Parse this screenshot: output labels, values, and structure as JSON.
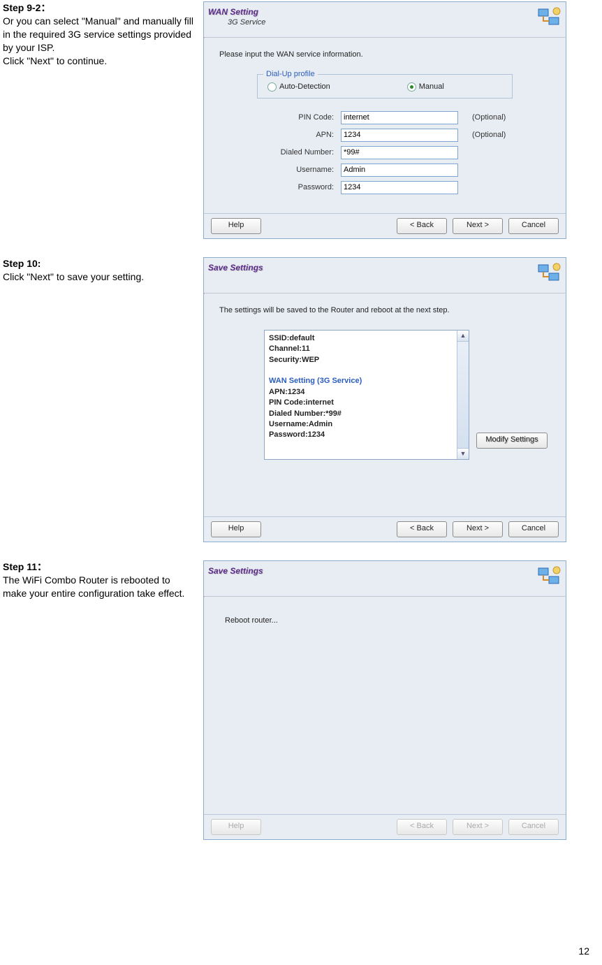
{
  "step9": {
    "title": "Step 9-2：",
    "body1": "Or you can select \"Manual\" and manually fill in the required 3G service settings provided by your ISP.",
    "body2": "Click \"Next\" to continue."
  },
  "step10": {
    "title": "Step 10:",
    "body1": "Click \"Next\" to save your setting."
  },
  "step11": {
    "title": "Step 11：",
    "body1": "The WiFi Combo Router is rebooted to make your entire configuration take effect."
  },
  "win1": {
    "title": "WAN Setting",
    "subtitle": "3G Service",
    "instr": "Please input the WAN service information.",
    "legend": "Dial-Up profile",
    "radio_auto": "Auto-Detection",
    "radio_manual": "Manual",
    "fields": {
      "pin_label": "PIN Code:",
      "pin_value": "internet",
      "pin_opt": "(Optional)",
      "apn_label": "APN:",
      "apn_value": "1234",
      "apn_opt": "(Optional)",
      "dial_label": "Dialed Number:",
      "dial_value": "*99#",
      "user_label": "Username:",
      "user_value": "Admin",
      "pass_label": "Password:",
      "pass_value": "1234"
    },
    "buttons": {
      "help": "Help",
      "back": "<  Back",
      "next": "Next >",
      "cancel": "Cancel"
    }
  },
  "win2": {
    "title": "Save Settings",
    "instr": "The settings will be saved to the Router and reboot at the next step.",
    "summary": {
      "l1": "SSID:default",
      "l2": "Channel:11",
      "l3": "Security:WEP",
      "l4": "WAN Setting  (3G Service)",
      "l5": "APN:1234",
      "l6": "PIN Code:internet",
      "l7": "Dialed Number:*99#",
      "l8": "Username:Admin",
      "l9": "Password:1234"
    },
    "modify": "Modify Settings",
    "buttons": {
      "help": "Help",
      "back": "<  Back",
      "next": "Next >",
      "cancel": "Cancel"
    }
  },
  "win3": {
    "title": "Save Settings",
    "body": "Reboot router...",
    "buttons": {
      "help": "Help",
      "back": "<  Back",
      "next": "Next >",
      "cancel": "Cancel"
    }
  },
  "page_number": "12"
}
